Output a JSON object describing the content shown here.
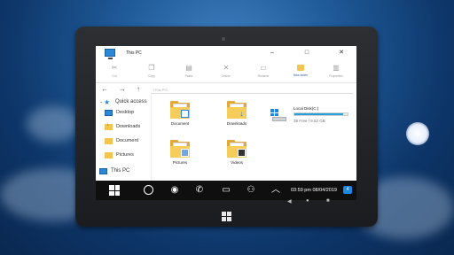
{
  "window": {
    "title": "This PC",
    "minimize": "–",
    "maximize": "□",
    "close": "✕"
  },
  "ribbon": [
    {
      "name": "cut-button",
      "icon": "scissors-icon",
      "glyph": "✂",
      "label": "Cut"
    },
    {
      "name": "copy-button",
      "icon": "copy-icon",
      "glyph": "❐",
      "label": "Copy"
    },
    {
      "name": "paste-button",
      "icon": "clipboard-icon",
      "glyph": "▤",
      "label": "Paste"
    },
    {
      "name": "delete-button",
      "icon": "delete-icon",
      "glyph": "✕",
      "label": "Delete"
    },
    {
      "name": "rename-button",
      "icon": "rename-icon",
      "glyph": "▭",
      "label": "Rename"
    },
    {
      "name": "new-folder-button",
      "icon": "new-folder-icon",
      "glyph": "",
      "label": "New folder"
    },
    {
      "name": "properties-button",
      "icon": "properties-icon",
      "glyph": "▥",
      "label": "Properties"
    }
  ],
  "nav": {
    "back": "←",
    "forward": "→",
    "up": "↑",
    "address": "\\This PC\\"
  },
  "sidebar": {
    "quick_access": "Quick access",
    "items": [
      "Desktop",
      "Downloads",
      "Document",
      "Pictures"
    ],
    "this_pc": "This PC"
  },
  "folders": [
    "Document",
    "Downloads",
    "Pictures",
    "Videos"
  ],
  "drive": {
    "name": "Local Disk(C:)",
    "free": "39 Free / 9.52 GB",
    "used_fraction": 0.92
  },
  "taskbar": {
    "clock": "03:59 pm 08/04/2019",
    "notifications": "4"
  },
  "android_nav": {
    "back": "◀",
    "home": "●",
    "recent": "■"
  },
  "colors": {
    "accent": "#2b88d8",
    "folder": "#f6cc5b",
    "taskbar": "#0f0f10"
  }
}
